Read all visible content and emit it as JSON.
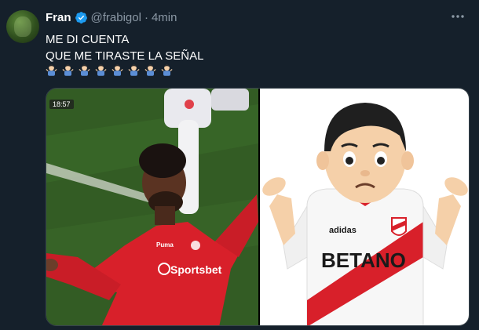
{
  "tweet": {
    "author": {
      "name": "Fran",
      "handle": "@frabigol",
      "verified": true
    },
    "separator": "·",
    "time": "4min",
    "text_lines": [
      "ME DI CUENTA",
      "QUE ME TIRASTE LA SEÑAL"
    ],
    "emoji": {
      "name": "person-shrugging-emoji",
      "count": 8
    },
    "media": {
      "left_photo": {
        "description_icon": "soccer-player-photo",
        "timestamp": "18:57",
        "jersey_sponsor": "Sportsbet",
        "small_logo": "Puma"
      },
      "right_image": {
        "icon": "shrugging-man-river-plate-emoji",
        "jersey_sponsor": "BETANO",
        "jersey_brand": "adidas"
      }
    }
  },
  "colors": {
    "background": "#15202b",
    "text_primary": "#ffffff",
    "text_secondary": "#8b98a5",
    "verified_blue": "#1d9bf0",
    "jersey_red": "#d8202a"
  }
}
